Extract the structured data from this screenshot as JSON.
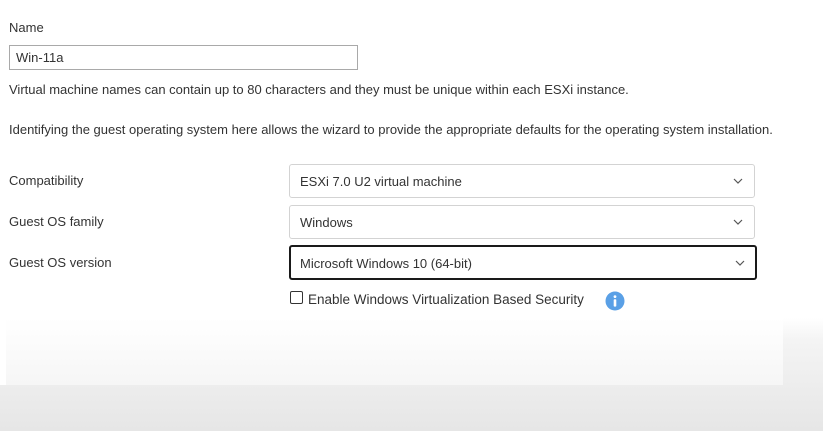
{
  "form": {
    "name_label": "Name",
    "name_value": "Win-11a",
    "name_hint": "Virtual machine names can contain up to 80 characters and they must be unique within each ESXi instance.",
    "guest_os_info": "Identifying the guest operating system here allows the wizard to provide the appropriate defaults for the operating system installation.",
    "compatibility": {
      "label": "Compatibility",
      "value": "ESXi 7.0 U2 virtual machine"
    },
    "guest_os_family": {
      "label": "Guest OS family",
      "value": "Windows"
    },
    "guest_os_version": {
      "label": "Guest OS version",
      "value": "Microsoft Windows 10 (64-bit)"
    },
    "vbs_checkbox": {
      "label": "Enable Windows Virtualization Based Security",
      "checked": false
    }
  },
  "icons": {
    "dropdown": "chevron-down-icon",
    "help": "info-icon"
  },
  "colors": {
    "text": "#333333",
    "input_border": "#a9a9a9",
    "select_border": "#d3d3d3",
    "focused_border": "#1a1a1a",
    "info_icon": "#5aa0e6"
  }
}
